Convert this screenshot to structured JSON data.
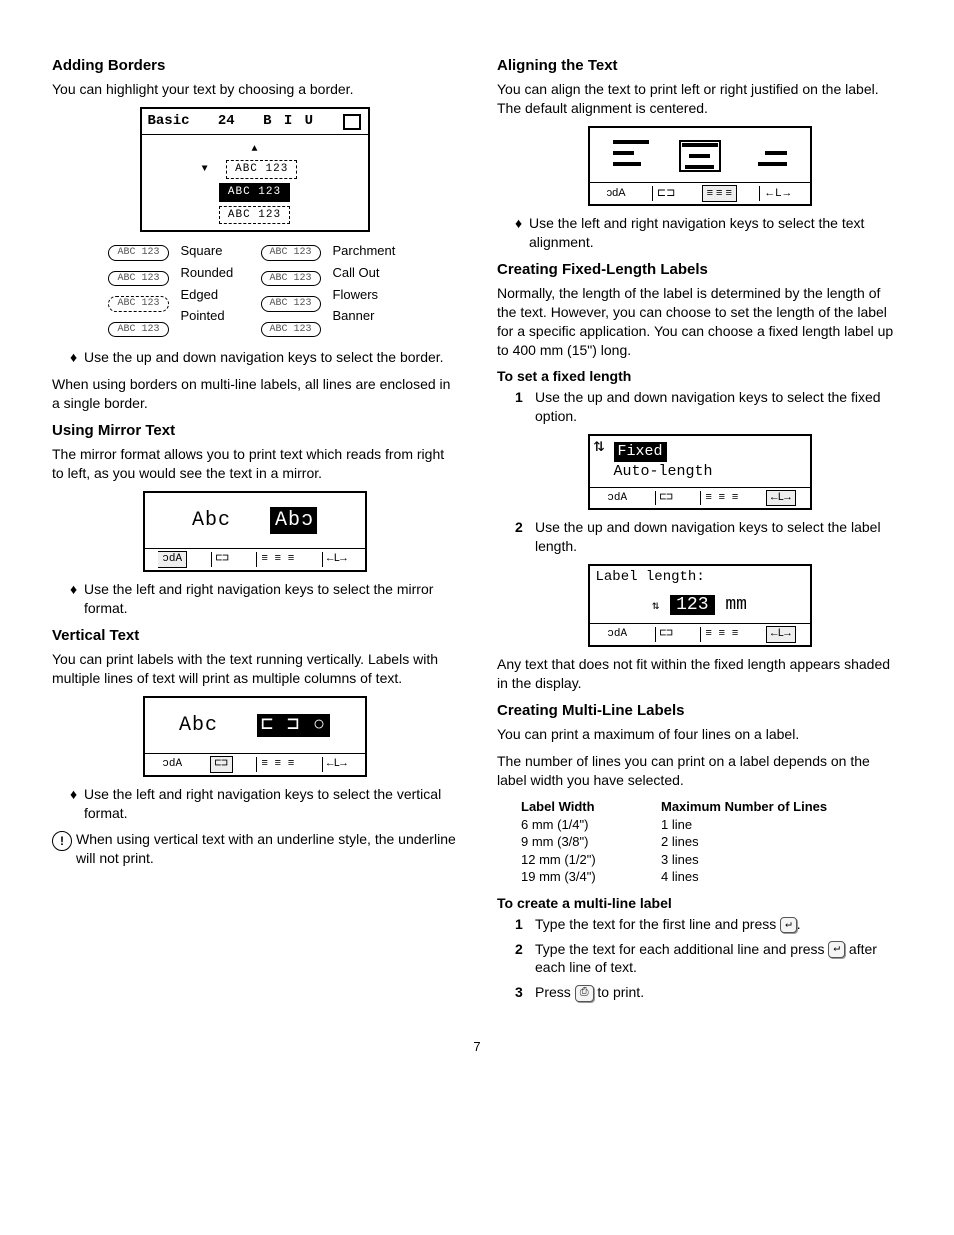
{
  "left": {
    "adding_borders": {
      "heading": "Adding Borders",
      "intro": "You can highlight your text by choosing a border.",
      "lcd": {
        "title": "Basic",
        "size": "24",
        "style": "B I U",
        "sample": "ABC 123"
      },
      "border_table": {
        "style1": "Square",
        "style2": "Rounded",
        "style3": "Edged",
        "style4": "Pointed",
        "style5": "Parchment",
        "style6": "Call Out",
        "style7": "Flowers",
        "style8": "Banner",
        "sample": "ABC 123"
      },
      "bullet": "Use the up and down navigation keys to select the border.",
      "note": "When using borders on multi-line labels, all lines are enclosed in a single border."
    },
    "mirror": {
      "heading": "Using Mirror Text",
      "intro": "The mirror format allows you to print text which reads from right to left, as you would see the text in a mirror.",
      "lcd_normal": "Abc",
      "lcd_mirrored": "cdA",
      "bullet": "Use the left and right navigation keys to select the mirror format."
    },
    "vertical": {
      "heading": "Vertical Text",
      "intro": "You can print labels with the text running vertically. Labels with multiple lines of text will print as multiple columns of text.",
      "lcd_text": "Abc",
      "bullet": "Use the left and right navigation keys to select the vertical format.",
      "caution": "When using vertical text with an underline style, the underline will not print."
    }
  },
  "right": {
    "align": {
      "heading": "Aligning the Text",
      "intro": "You can align the text to print left or right justified on the label. The default alignment is centered.",
      "bullet": "Use the left and right navigation keys to select the text alignment."
    },
    "fixed": {
      "heading": "Creating Fixed-Length Labels",
      "intro": "Normally, the length of the label is determined by the length of the text. However, you can choose to set the length of the label for a specific application. You can choose a fixed length label up to 400 mm (15\") long.",
      "step_heading": "To set a fixed length",
      "step1": "Use the up and down navigation keys to select the fixed option.",
      "lcd_opt1": "Fixed",
      "lcd_opt2": "Auto-length",
      "step2": "Use the up and down navigation keys to select the label length.",
      "len_title": "Label length:",
      "len_value": "123",
      "len_unit": "mm",
      "note": "Any text that does not fit within the fixed length appears shaded in the display."
    },
    "multiline": {
      "heading": "Creating Multi-Line Labels",
      "intro1": "You can print a maximum of four lines on a label.",
      "intro2": "The number of lines you can print on a label depends on the label width you have selected.",
      "table": {
        "hdr1": "Label Width",
        "hdr2": "Maximum Number of Lines",
        "rows": [
          {
            "w": "6 mm (1/4\")",
            "l": "1 line"
          },
          {
            "w": "9 mm (3/8\")",
            "l": "2 lines"
          },
          {
            "w": "12 mm (1/2\")",
            "l": "3 lines"
          },
          {
            "w": "19 mm (3/4\")",
            "l": "4 lines"
          }
        ]
      },
      "step_heading": "To create a multi-line label",
      "step1a": "Type the text for the first line and press ",
      "step1b": ".",
      "step2a": "Type the text for each additional line and press ",
      "step2b": "after each line of text.",
      "step3a": "Press ",
      "step3b": " to print.",
      "enter_key": "↵",
      "print_key": "⎙"
    }
  },
  "status_bar": {
    "mirror_abc": "ɔdA",
    "vertical": "⊏⊐",
    "align": "☰",
    "length": "←L→"
  },
  "page_number": "7"
}
